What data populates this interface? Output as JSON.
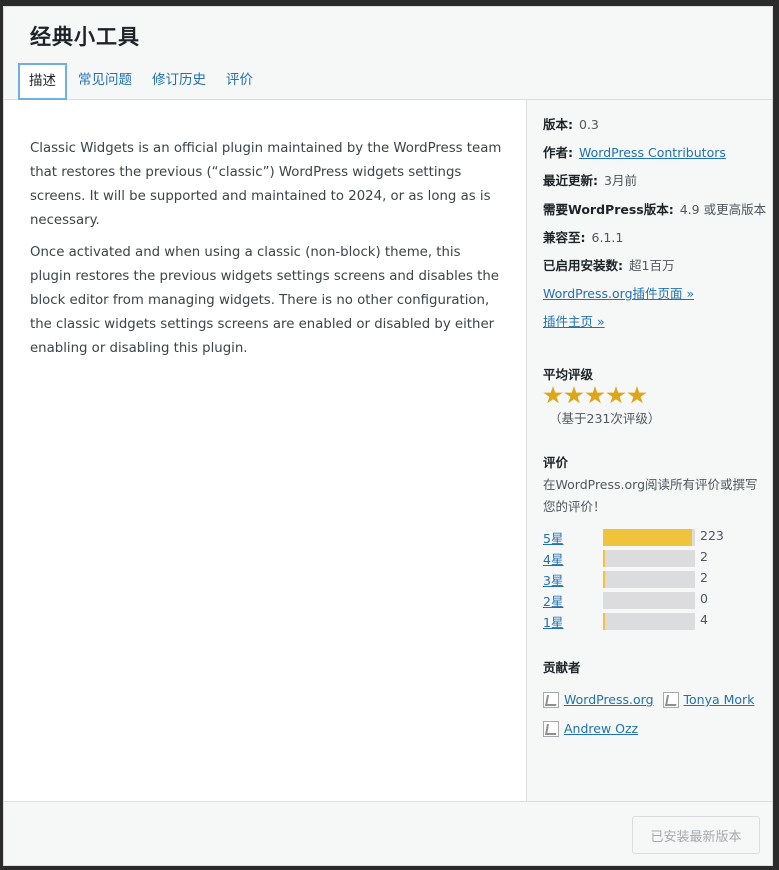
{
  "modal": {
    "title": "经典小工具",
    "tabs": [
      "描述",
      "常见问题",
      "修订历史",
      "评价"
    ]
  },
  "description": {
    "paragraphs": [
      "Classic Widgets is an official plugin maintained by the WordPress team that restores the previous (“classic”) WordPress widgets settings screens. It will be supported and maintained to 2024, or as long as is necessary.",
      "Once activated and when using a classic (non-block) theme, this plugin restores the previous widgets settings screens and disables the block editor from managing widgets. There is no other configuration, the classic widgets settings screens are enabled or disabled by either enabling or disabling this plugin."
    ]
  },
  "sidebar": {
    "version_label": "版本:",
    "version": "0.3",
    "author_label": "作者:",
    "author": "WordPress Contributors",
    "updated_label": "最近更新:",
    "updated": "3月前",
    "requires_label": "需要WordPress版本:",
    "requires": "4.9 或更高版本",
    "tested_label": "兼容至:",
    "tested": "6.1.1",
    "installs_label": "已启用安装数:",
    "installs": "超1百万",
    "plugin_page_link": "WordPress.org插件页面 »",
    "homepage_link": "插件主页 »",
    "avg_rating_title": "平均评级",
    "rating_value": 5,
    "rating_count": "（基于231次评级）",
    "reviews_title": "评价",
    "reviews_text": "在WordPress.org阅读所有评价或撰写您的评价！",
    "ratings": [
      {
        "label": "5星",
        "count": "223",
        "value": 223
      },
      {
        "label": "4星",
        "count": "2",
        "value": 2
      },
      {
        "label": "3星",
        "count": "2",
        "value": 2
      },
      {
        "label": "2星",
        "count": "0",
        "value": 0
      },
      {
        "label": "1星",
        "count": "4",
        "value": 4
      }
    ],
    "contributors_title": "贡献者",
    "contributors": [
      "WordPress.org",
      "Tonya Mork",
      "Andrew Ozz"
    ]
  },
  "footer": {
    "install_button": "已安装最新版本"
  },
  "colors": {
    "accent": "#2271b1",
    "star": "#dba617",
    "bar_fill": "#f0c33c"
  }
}
